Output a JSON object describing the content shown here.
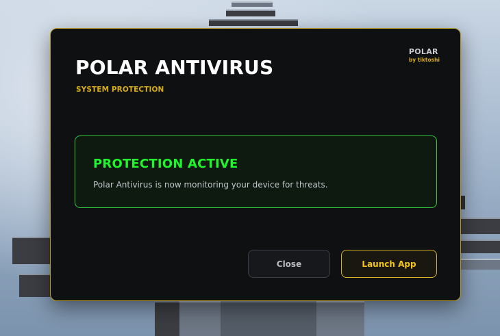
{
  "dialog": {
    "title": "POLAR ANTIVIRUS",
    "subtitle": "SYSTEM PROTECTION",
    "brand": {
      "name": "POLAR",
      "by": "by tiktoshi"
    },
    "status": {
      "title": "PROTECTION ACTIVE",
      "description": "Polar Antivirus is now monitoring your device for threats."
    },
    "buttons": {
      "close": "Close",
      "launch": "Launch App"
    }
  },
  "colors": {
    "accent": "#d6ac1c",
    "success": "#1ef52c",
    "dialog_bg": "#0f1012"
  }
}
